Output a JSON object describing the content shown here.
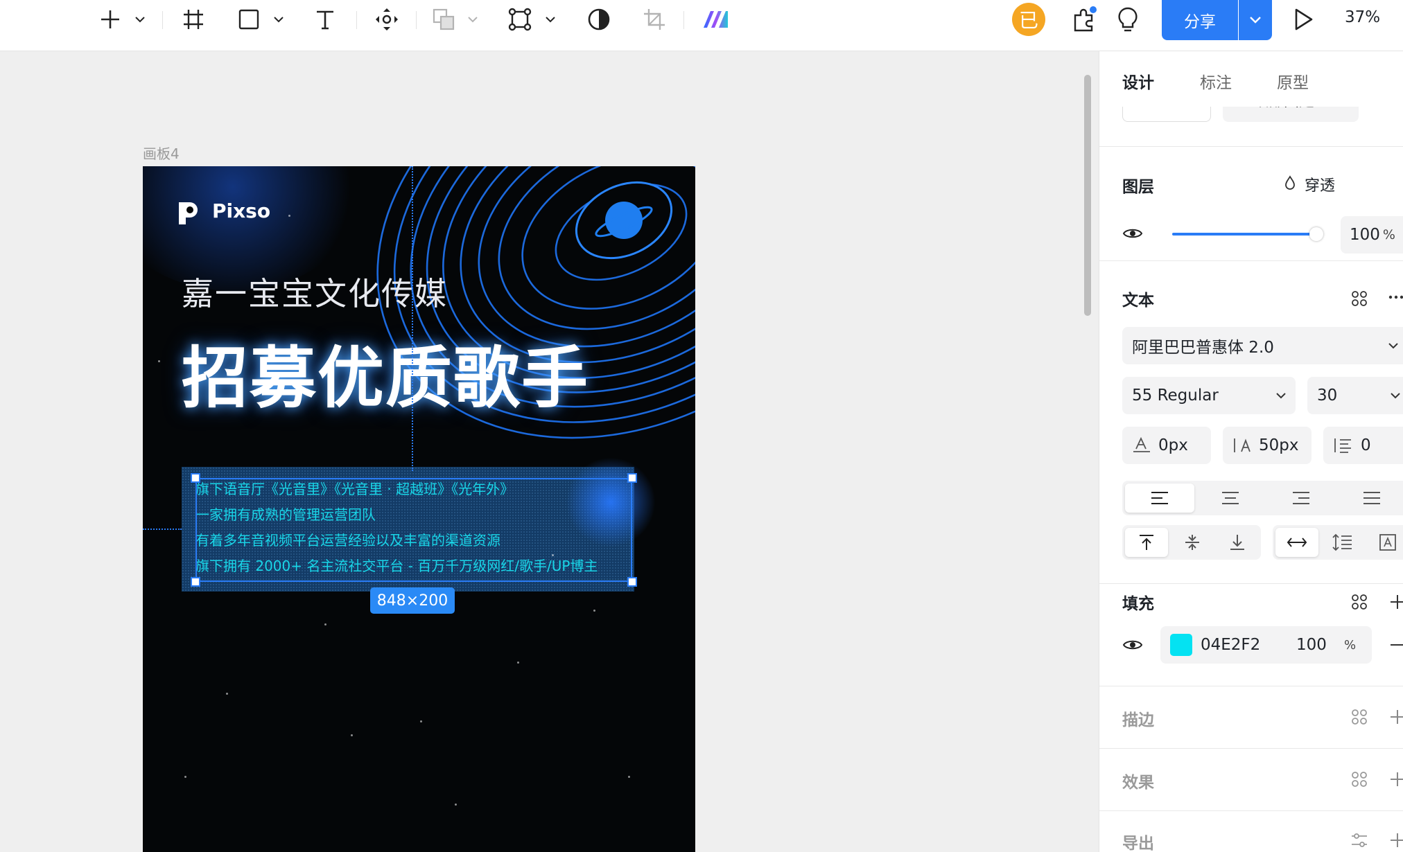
{
  "toolbar": {
    "avatar_label": "已",
    "share_label": "分享",
    "zoom_label": "37%"
  },
  "canvas": {
    "frame_label": "画板4",
    "poster": {
      "logo_text": "Pixso",
      "subtitle": "嘉一宝宝文化传媒",
      "title": "招募优质歌手",
      "lines": [
        "旗下语音厅《光音里》《光音里 · 超越班》《光年外》",
        "一家拥有成熟的管理运营团队",
        "有着多年音视频平台运营经验以及丰富的渠道资源",
        "旗下拥有 2000+ 名主流社交平台 - 百万千万级网红/歌手/UP博主"
      ],
      "text_color": "#19D6E8"
    },
    "selection_size": "848×200",
    "selection_color": "#2A7CF6"
  },
  "panel": {
    "tabs": [
      {
        "label": "设计",
        "active": true
      },
      {
        "label": "标注",
        "active": false
      },
      {
        "label": "原型",
        "active": false
      }
    ],
    "clipped_dropdown": "顶部固定",
    "layer": {
      "title": "图层",
      "blend_mode": "穿透",
      "opacity_value": "100",
      "opacity_unit": "%",
      "opacity_level": 1.0
    },
    "text": {
      "title": "文本",
      "font_family": "阿里巴巴普惠体 2.0",
      "font_weight": "55 Regular",
      "font_size": "30",
      "letter_spacing": "0px",
      "line_height": "50px",
      "paragraph_spacing": "0"
    },
    "fill": {
      "title": "填充",
      "color_hex": "04E2F2",
      "color": "#04E2F2",
      "opacity": "100",
      "unit": "%"
    },
    "stroke": {
      "title": "描边"
    },
    "effect": {
      "title": "效果"
    },
    "export": {
      "title": "导出"
    }
  }
}
